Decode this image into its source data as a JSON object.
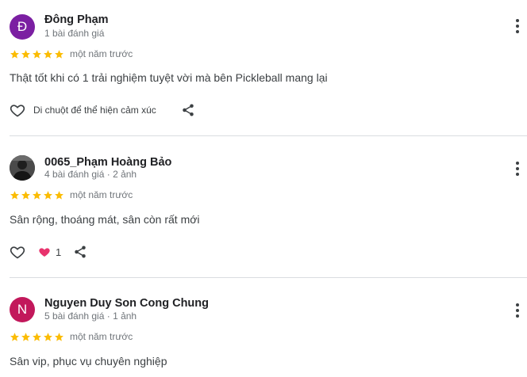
{
  "colors": {
    "star": "#fbbc04",
    "avatar_purple": "#7b1fa2",
    "avatar_pink": "#c2185b",
    "like_heart": "#e8336d"
  },
  "reviews": [
    {
      "avatar_letter": "Đ",
      "name": "Đông Phạm",
      "meta": "1 bài đánh giá",
      "rating": 5,
      "when": "một năm trước",
      "text": "Thật tốt khi có 1 trải nghiệm tuyệt vời mà bên Pickleball mang lại",
      "hover_hint": "Di chuột để thể hiện cảm xúc"
    },
    {
      "avatar_letter": "",
      "name": "0065_Phạm Hoàng Bảo",
      "meta": "4 bài đánh giá · 2 ảnh",
      "rating": 5,
      "when": "một năm trước",
      "text": "Sân rộng, thoáng mát, sân còn rất mới",
      "like_count": "1"
    },
    {
      "avatar_letter": "N",
      "name": "Nguyen Duy Son Cong Chung",
      "meta": "5 bài đánh giá · 1 ảnh",
      "rating": 5,
      "when": "một năm trước",
      "text": "Sân vip, phục vụ chuyên nghiệp"
    }
  ]
}
